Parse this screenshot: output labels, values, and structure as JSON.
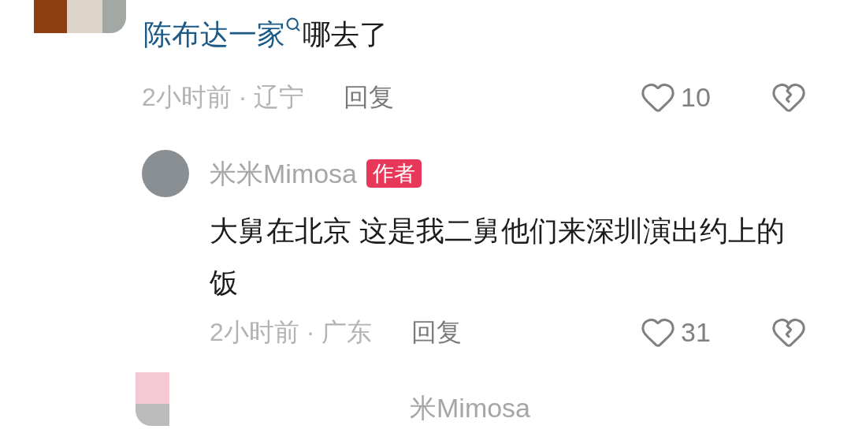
{
  "comments": [
    {
      "kind": "top",
      "text_link": "陈布达一家",
      "text": "哪去了",
      "meta": "2小时前 · 辽宁",
      "reply_label": "回复",
      "likes": "10"
    },
    {
      "kind": "reply",
      "author": "米米Mimosa",
      "badge": "作者",
      "text": "大舅在北京 这是我二舅他们来深圳演出约上的饭",
      "meta": "2小时前 · 广东",
      "reply_label": "回复",
      "likes": "31"
    },
    {
      "kind": "cut",
      "author": "米Mimosa"
    }
  ]
}
